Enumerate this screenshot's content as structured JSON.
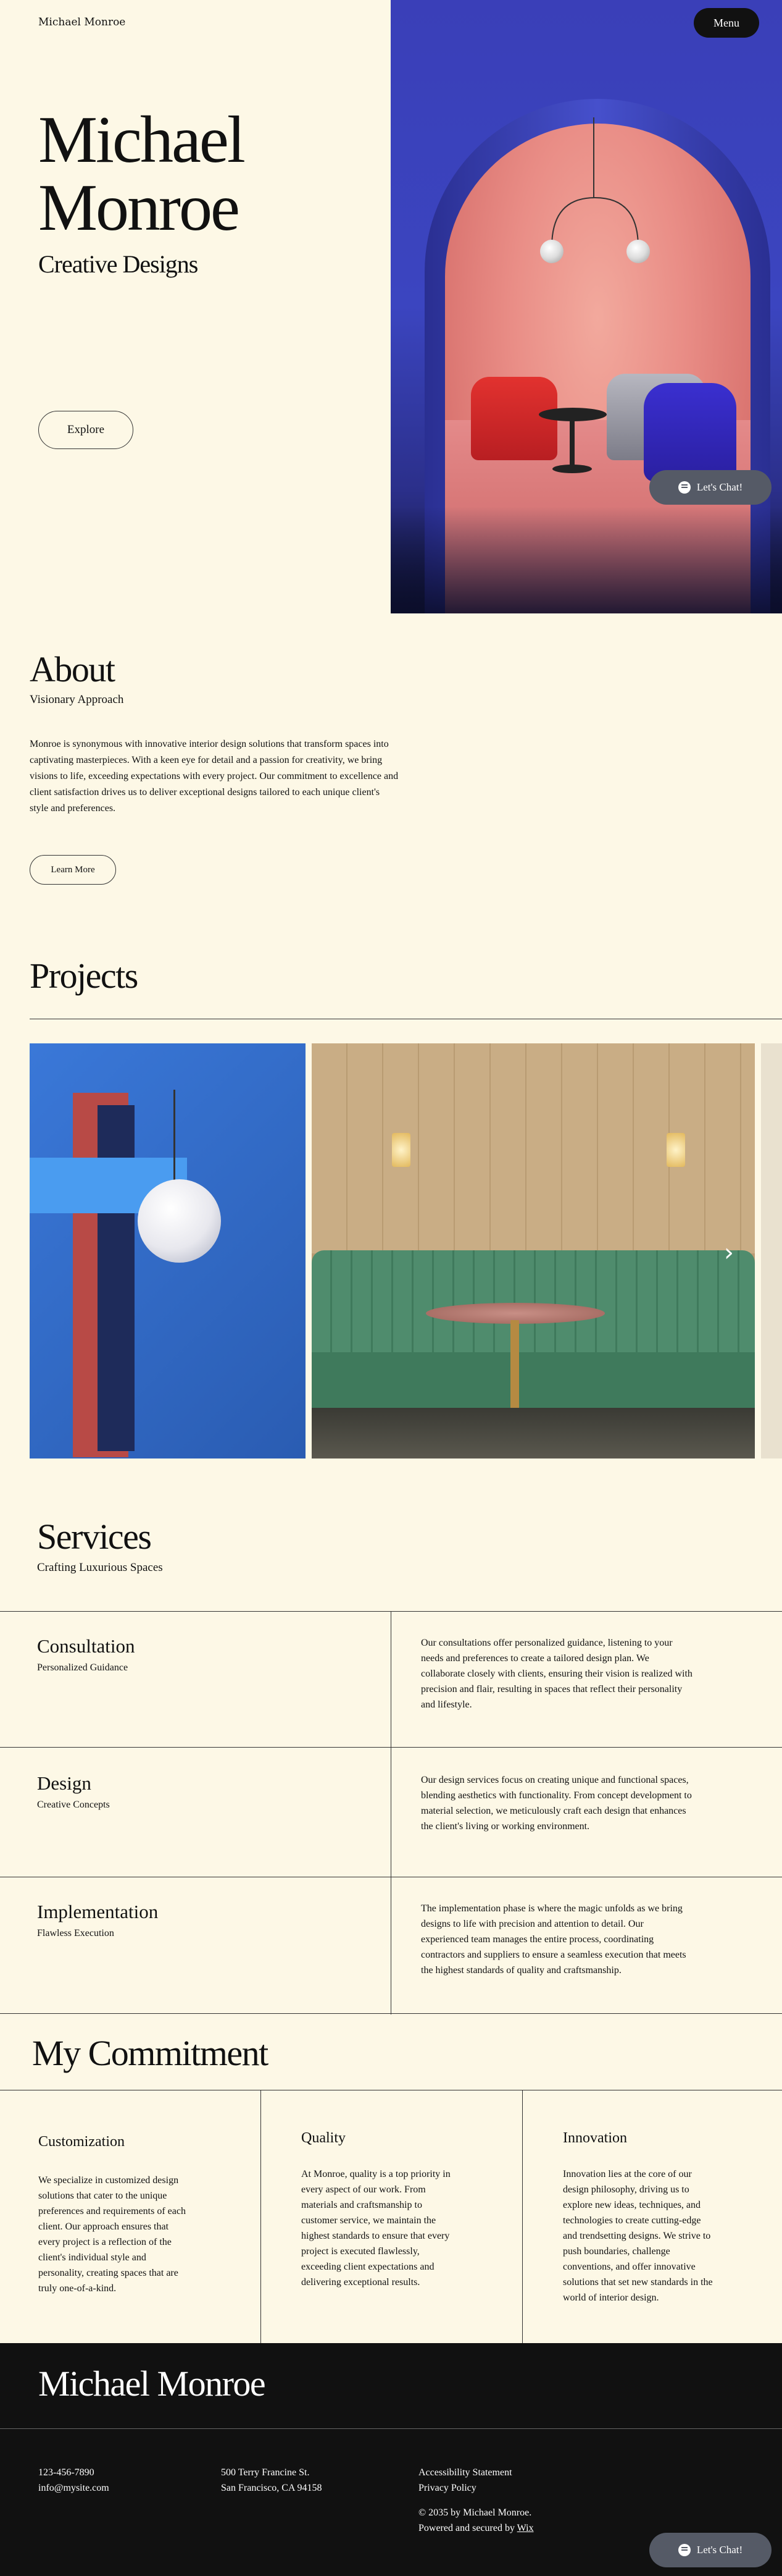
{
  "header": {
    "site_name": "Michael Monroe",
    "menu_label": "Menu"
  },
  "hero": {
    "title_line1": "Michael",
    "title_line2": "Monroe",
    "subtitle": "Creative Designs",
    "button": "Explore"
  },
  "chat": {
    "label": "Let's Chat!"
  },
  "about": {
    "title": "About",
    "subtitle": "Visionary Approach",
    "text": "Monroe is synonymous with innovative interior design solutions that transform spaces into captivating masterpieces. With a keen eye for detail and a passion for creativity, we bring visions to life, exceeding expectations with every project. Our commitment to excellence and client satisfaction drives us to deliver exceptional designs tailored to each unique client's style and preferences.",
    "button": "Learn More"
  },
  "projects": {
    "title": "Projects",
    "next_icon": "chevron-right-icon"
  },
  "services": {
    "title": "Services",
    "subtitle": "Crafting Luxurious Spaces",
    "items": [
      {
        "name": "Consultation",
        "tag": "Personalized Guidance",
        "text": "Our consultations offer personalized guidance, listening to your needs and preferences to create a tailored design plan. We collaborate closely with clients, ensuring their vision is realized with precision and flair, resulting in spaces that reflect their personality and lifestyle."
      },
      {
        "name": "Design",
        "tag": "Creative Concepts",
        "text": "Our design services focus on creating unique and functional spaces, blending aesthetics with functionality. From concept development to material selection, we meticulously craft each design that enhances the client's living or working environment."
      },
      {
        "name": "Implementation",
        "tag": "Flawless Execution",
        "text": "The implementation phase is where the magic unfolds as we bring designs to life with precision and attention to detail. Our experienced team manages the entire process, coordinating contractors and suppliers to ensure a seamless execution that meets the highest standards of quality and craftsmanship."
      }
    ]
  },
  "commitment": {
    "title": "My Commitment",
    "items": [
      {
        "name": "Customization",
        "text": "We specialize in customized design solutions that cater to the unique preferences and requirements of each client. Our approach ensures that every project is a reflection of the client's individual style and personality, creating spaces that are truly one-of-a-kind."
      },
      {
        "name": "Quality",
        "text": "At Monroe, quality is a top priority in every aspect of our work. From materials and craftsmanship to customer service, we maintain the highest standards to ensure that every project is executed flawlessly, exceeding client expectations and delivering exceptional results."
      },
      {
        "name": "Innovation",
        "text": "Innovation lies at the core of our design philosophy, driving us to explore new ideas, techniques, and technologies to create cutting-edge and trendsetting designs. We strive to push boundaries, challenge conventions, and offer innovative solutions that set new standards in the world of interior design."
      }
    ]
  },
  "footer": {
    "name": "Michael Monroe",
    "phone": "123-456-7890",
    "email": "info@mysite.com",
    "address1": "500 Terry Francine St.",
    "address2": "San Francisco, CA 94158",
    "link1": "Accessibility Statement",
    "link2": "Privacy Policy",
    "copyright": "© 2035 by Michael Monroe.",
    "powered_prefix": "Powered and secured by ",
    "powered_link": "Wix"
  }
}
